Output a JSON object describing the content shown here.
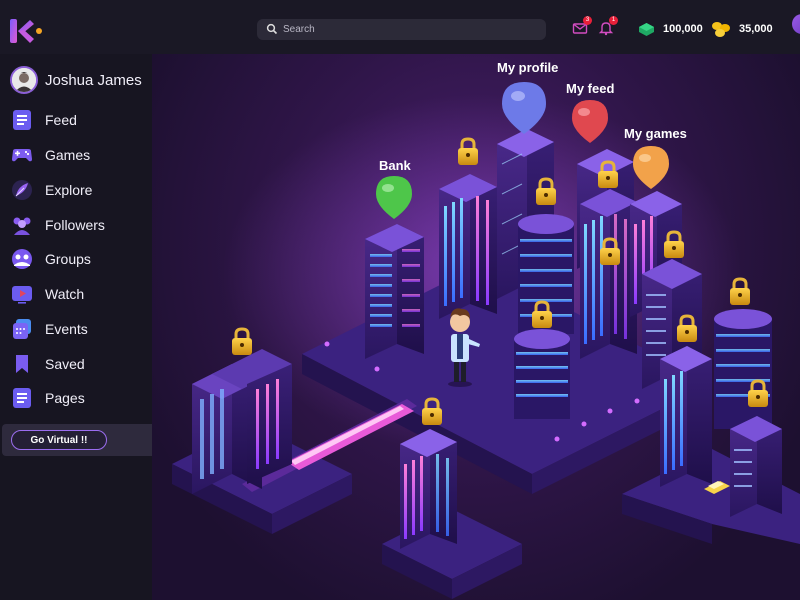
{
  "header": {
    "search_placeholder": "Search",
    "coins_primary": "100,000",
    "coins_secondary": "35,000",
    "mail_badge": "3",
    "bell_badge": "1"
  },
  "profile": {
    "name": "Joshua James"
  },
  "sidebar": {
    "items": [
      {
        "label": "Feed",
        "icon": "feed-icon"
      },
      {
        "label": "Games",
        "icon": "gamepad-icon"
      },
      {
        "label": "Explore",
        "icon": "feather-icon"
      },
      {
        "label": "Followers",
        "icon": "followers-icon"
      },
      {
        "label": "Groups",
        "icon": "groups-icon"
      },
      {
        "label": "Watch",
        "icon": "play-icon"
      },
      {
        "label": "Events",
        "icon": "calendar-icon"
      },
      {
        "label": "Saved",
        "icon": "bookmark-icon"
      },
      {
        "label": "Pages",
        "icon": "pages-icon"
      }
    ],
    "virtual_button": "Go Virtual  !!"
  },
  "scene": {
    "pins": [
      {
        "label": "My profile",
        "color": "#6d7ae8"
      },
      {
        "label": "My feed",
        "color": "#e0484f"
      },
      {
        "label": "My games",
        "color": "#f2a24a"
      },
      {
        "label": "Bank",
        "color": "#4ec64a"
      }
    ]
  },
  "colors": {
    "accent": "#9b6df0",
    "background": "#161420",
    "scene_purple": "#4a1f6e"
  }
}
